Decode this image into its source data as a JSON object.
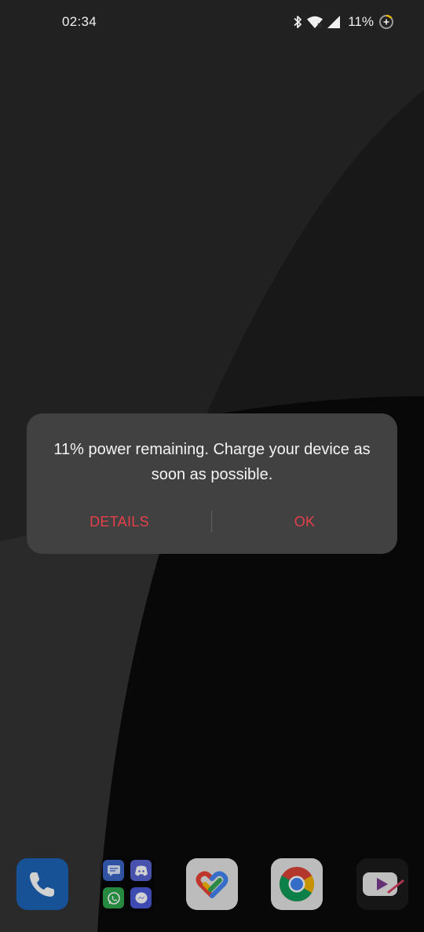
{
  "status_bar": {
    "time": "02:34",
    "battery_percent": "11%",
    "icons": [
      "bluetooth-icon",
      "wifi-icon",
      "signal-icon",
      "battery-saver-icon"
    ]
  },
  "dialog": {
    "message": "11% power remaining. Charge your device as soon as possible.",
    "details_label": "DETAILS",
    "ok_label": "OK",
    "accent_color": "#e5404a"
  },
  "dock": {
    "apps": [
      {
        "name": "phone",
        "icon": "phone-icon"
      },
      {
        "name": "folder",
        "icons": [
          "messages-icon",
          "discord-icon",
          "whatsapp-icon",
          "messenger-icon"
        ]
      },
      {
        "name": "google-fit",
        "icon": "google-fit-icon"
      },
      {
        "name": "chrome",
        "icon": "chrome-icon"
      },
      {
        "name": "youtube",
        "icon": "youtube-icon"
      }
    ]
  },
  "colors": {
    "background": "#303030",
    "dialog_bg": "#414141",
    "button_text": "#e5404a"
  }
}
